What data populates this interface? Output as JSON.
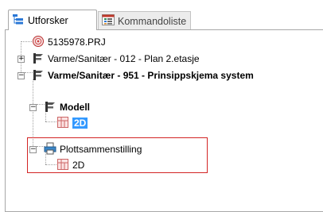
{
  "tabs": [
    {
      "label": "Utforsker",
      "icon": "tree-explorer-icon",
      "active": true
    },
    {
      "label": "Kommandoliste",
      "icon": "command-list-icon",
      "active": false
    }
  ],
  "tree": {
    "project": {
      "label": "5135978.PRJ",
      "icon": "project-file-icon"
    },
    "items": [
      {
        "label": "Varme/Sanitær - 012 - Plan 2.etasje",
        "expander": "+",
        "icon": "plumbing-drawing-icon"
      },
      {
        "label": "Varme/Sanitær - 951 - Prinsippskjema system",
        "expander": "−",
        "icon": "plumbing-drawing-icon",
        "bold": true
      },
      {
        "label": "Modell",
        "expander": "−",
        "icon": "plumbing-drawing-icon",
        "bold": true
      },
      {
        "label": "2D",
        "icon": "2d-view-icon",
        "bold": true,
        "selected": true
      },
      {
        "label": "Plottsammenstilling",
        "expander": "−",
        "icon": "printer-icon"
      },
      {
        "label": "2D",
        "icon": "2d-view-icon"
      }
    ]
  },
  "colors": {
    "selection": "#3399ff",
    "highlight_border": "#d32525"
  }
}
